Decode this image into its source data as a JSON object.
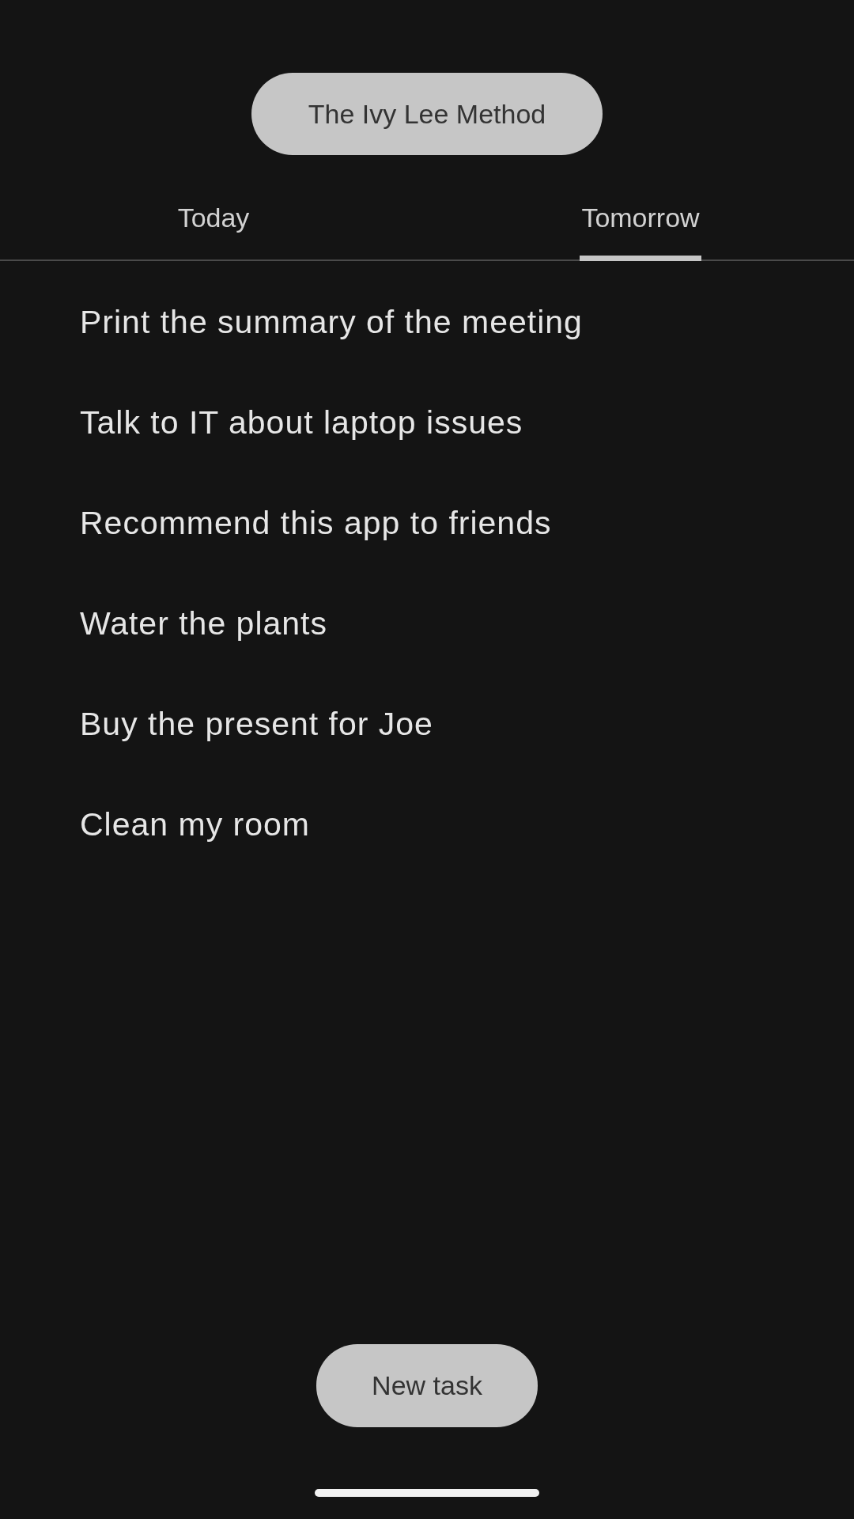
{
  "title_button": "The Ivy Lee Method",
  "tabs": [
    {
      "label": "Today",
      "selected": false
    },
    {
      "label": "Tomorrow",
      "selected": true
    }
  ],
  "tasks": [
    "Print the summary of the meeting",
    "Talk to IT about laptop issues",
    "Recommend this app to friends",
    "Water the plants",
    "Buy the present for Joe",
    "Clean my room"
  ],
  "new_task_button": "New task"
}
